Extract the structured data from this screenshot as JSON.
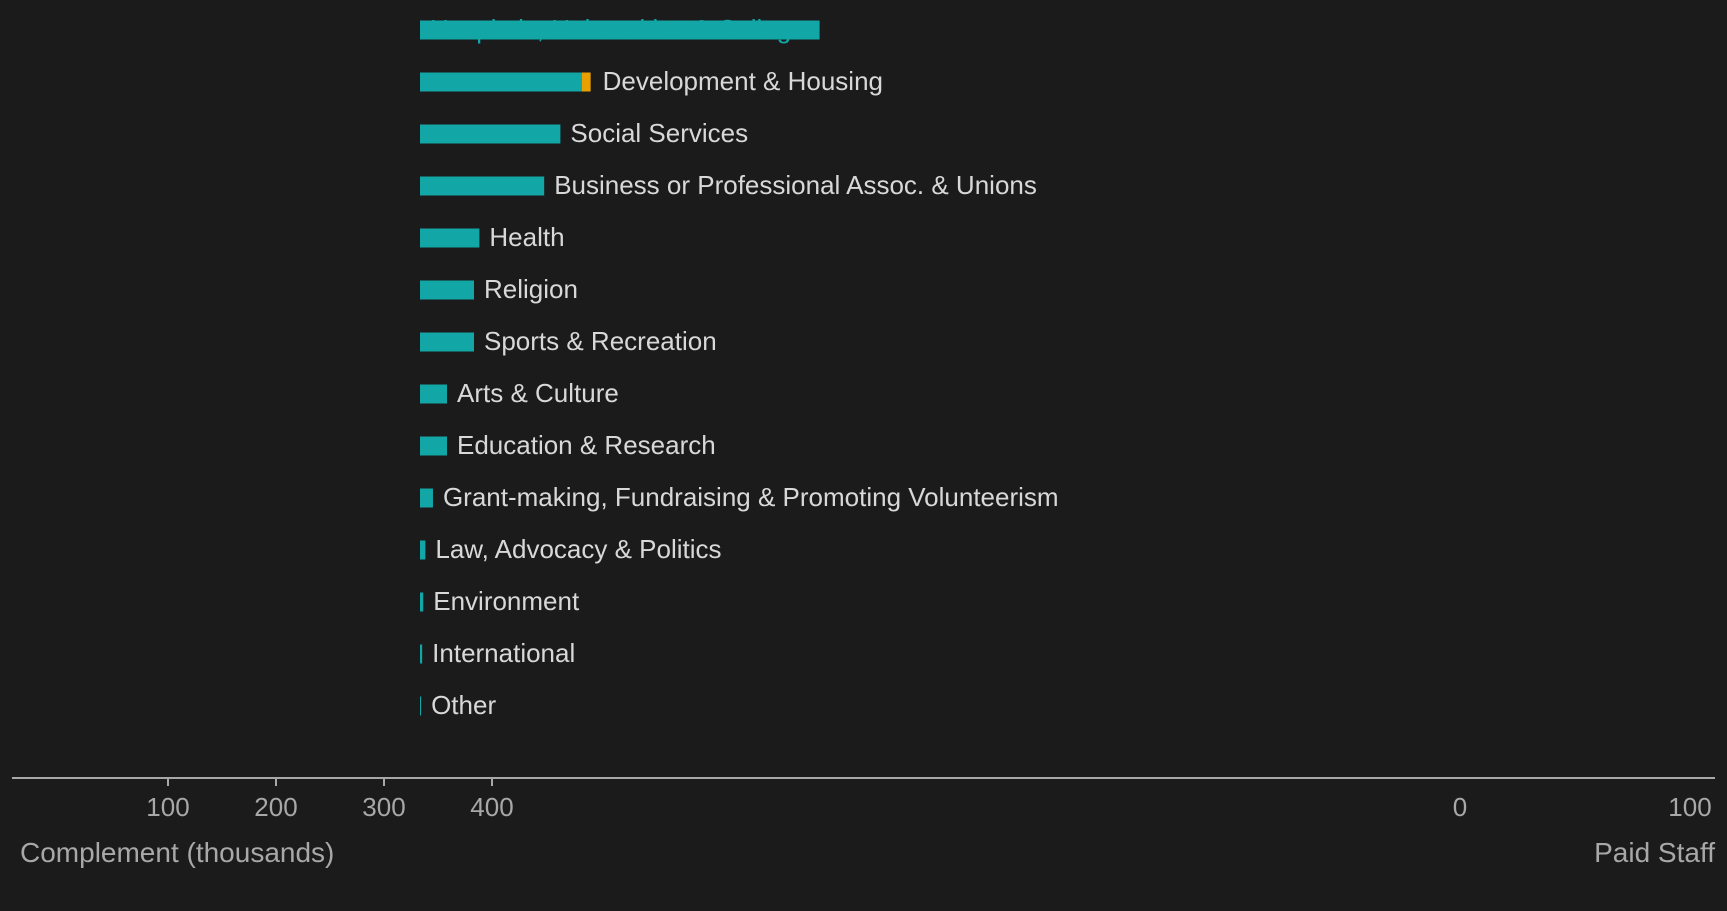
{
  "chart_data": {
    "type": "bar",
    "orientation": "horizontal",
    "categories": [
      "Hospitals, Universities & Colleges",
      "Development & Housing",
      "Social Services",
      "Business or Professional Assoc. & Unions",
      "Health",
      "Religion",
      "Sports & Recreation",
      "Arts & Culture",
      "Education & Research",
      "Grant-making, Fundraising & Promoting Volunteerism",
      "Law, Advocacy & Politics",
      "Environment",
      "International",
      "Other"
    ],
    "series": [
      {
        "name": "Paid Staff",
        "color": "#12a6a6",
        "values": [
          370,
          150,
          130,
          115,
          55,
          50,
          50,
          25,
          25,
          12,
          5,
          3,
          2,
          1
        ]
      }
    ],
    "volunteer_segment": {
      "category": "Development & Housing",
      "value": 8,
      "color": "#e8a000"
    },
    "xlabel": "Complement (thousands)",
    "xticks": [
      100,
      200,
      300,
      400
    ],
    "grid": false,
    "background": "#1b1b1b",
    "label_color": "#d8d8d8",
    "axis_color": "#a8a8a8"
  },
  "extra_labels": {
    "right_tick_zero": "0",
    "right_tick_hundred": "100",
    "right_axis_label": "Paid Staff"
  }
}
